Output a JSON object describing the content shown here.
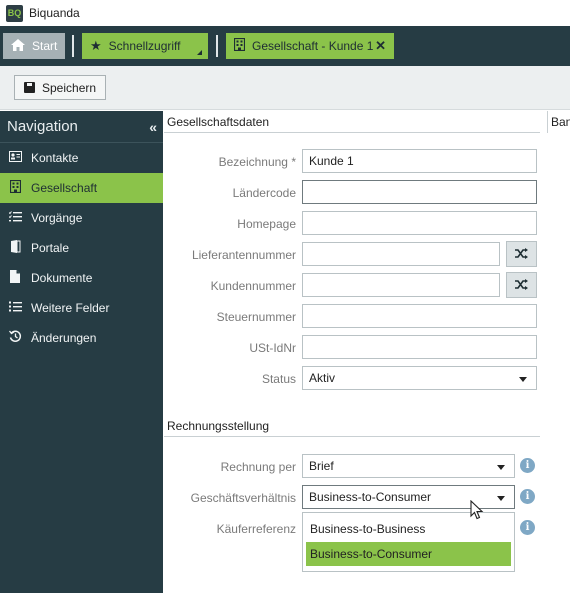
{
  "app": {
    "logo_text": "BQ",
    "title": "Biquanda"
  },
  "tabs": [
    {
      "label": "Start",
      "icon": "home-icon"
    },
    {
      "label": "Schnellzugriff",
      "icon": "star-icon"
    },
    {
      "label": "Gesellschaft - Kunde 1",
      "icon": "building-icon",
      "close": "✕"
    }
  ],
  "toolbar": {
    "save_label": "Speichern"
  },
  "nav": {
    "title": "Navigation",
    "collapse": "«",
    "items": [
      {
        "label": "Kontakte",
        "icon": "contact-card-icon"
      },
      {
        "label": "Gesellschaft",
        "icon": "building-icon",
        "active": true
      },
      {
        "label": "Vorgänge",
        "icon": "list-check-icon"
      },
      {
        "label": "Portale",
        "icon": "door-icon"
      },
      {
        "label": "Dokumente",
        "icon": "document-icon"
      },
      {
        "label": "Weitere Felder",
        "icon": "list-icon"
      },
      {
        "label": "Änderungen",
        "icon": "history-icon"
      }
    ]
  },
  "company_section": {
    "title": "Gesellschaftsdaten",
    "side_panel_title": "Ban",
    "fields": {
      "bezeichnung": {
        "label": "Bezeichnung",
        "required_mark": "*",
        "value": "Kunde 1"
      },
      "laendercode": {
        "label": "Ländercode",
        "value": ""
      },
      "homepage": {
        "label": "Homepage",
        "value": ""
      },
      "lieferantennummer": {
        "label": "Lieferantennummer",
        "value": ""
      },
      "kundennummer": {
        "label": "Kundennummer",
        "value": ""
      },
      "steuernummer": {
        "label": "Steuernummer",
        "value": ""
      },
      "ust_idnr": {
        "label": "USt-IdNr",
        "value": ""
      },
      "status": {
        "label": "Status",
        "value": "Aktiv"
      }
    }
  },
  "billing_section": {
    "title": "Rechnungsstellung",
    "fields": {
      "rechnung_per": {
        "label": "Rechnung per",
        "value": "Brief"
      },
      "geschaeftsverhaeltnis": {
        "label": "Geschäftsverhältnis",
        "value": "Business-to-Consumer"
      },
      "kaeuferreferenz": {
        "label": "Käuferreferenz"
      }
    },
    "dropdown_options": [
      {
        "label": "Business-to-Business",
        "selected": false
      },
      {
        "label": "Business-to-Consumer",
        "selected": true
      }
    ],
    "info_glyph": "i"
  },
  "colors": {
    "accent": "#8bc34a",
    "dark": "#263c44",
    "info": "#7fa8c5"
  }
}
